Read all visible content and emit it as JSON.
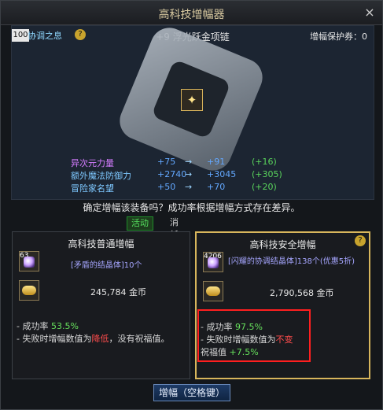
{
  "window": {
    "title": "高科技增幅器",
    "close_label": "×"
  },
  "top": {
    "level": "100",
    "buff_name": "协调之息",
    "help_label": "?",
    "item_name": "+9 浮光跃金项链",
    "protect_label": "增幅保护券：0"
  },
  "stats": [
    {
      "name": "异次元力量",
      "old": "+75",
      "arrow": "→",
      "new": "+91",
      "diff": "(+16)"
    },
    {
      "name": "额外魔法防御力",
      "old": "+2740",
      "arrow": "→",
      "new": "+3045",
      "diff": "(+305)"
    },
    {
      "name": "冒险家名望",
      "old": "+50",
      "arrow": "→",
      "new": "+70",
      "diff": "(+20)"
    }
  ],
  "confirm_text": "确定增幅该装备吗？成功率根据增幅方式存在差异。",
  "tabs": [
    {
      "label": "活动"
    },
    {
      "label": "消耗材料"
    }
  ],
  "normal": {
    "title": "高科技普通增幅",
    "material_count": "63",
    "material_text": "[矛盾的结晶体]10个",
    "gold_text": "245,784 金币",
    "success_label": "- 成功率 ",
    "success_value": "53.5%",
    "fail_text_1": "- 失败时增幅数值为",
    "fail_bad": "降低",
    "fail_text_2": "，没有祝福值。"
  },
  "safe": {
    "title": "高科技安全增幅",
    "help_label": "?",
    "material_count": "4206",
    "material_text": "[闪耀的协调结晶体]138个(优惠5折)",
    "gold_text": "2,790,568 金币",
    "success_label": "- 成功率 ",
    "success_value": "97.5%",
    "fail_text": "- 失败时增幅数值为",
    "fail_bad": "不变",
    "blessing_label": "祝福值 ",
    "blessing_value": "+7.5%"
  },
  "buttons": {
    "enhance": "增幅（空格键）"
  },
  "colors": {
    "accent_gold": "#d8b65c",
    "success_green": "#66e05c",
    "fail_red": "#ff4c4c"
  }
}
